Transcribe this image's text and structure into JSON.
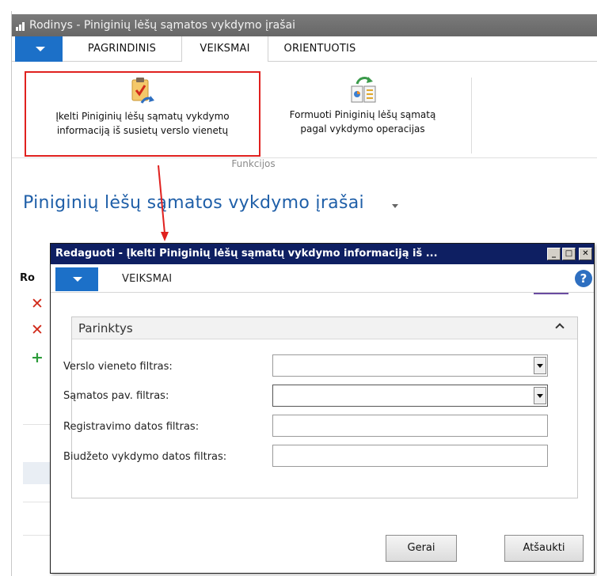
{
  "window": {
    "title": "Rodinys - Piniginių lėšų sąmatos vykdymo įrašai"
  },
  "ribbon": {
    "tabs": [
      "PAGRINDINIS",
      "VEIKSMAI",
      "ORIENTUOTIS"
    ],
    "active_tab": "VEIKSMAI",
    "buttons": [
      {
        "line1": "Įkelti Piniginių lėšų sąmatų vykdymo",
        "line2": "informaciją iš susietų verslo vienetų",
        "highlighted": true
      },
      {
        "line1": "Formuoti Piniginių lėšų sąmatą",
        "line2": "pagal vykdymo operacijas",
        "highlighted": false
      }
    ],
    "group_label": "Funkcijos"
  },
  "page": {
    "title": "Piniginių lėšų sąmatos vykdymo įrašai",
    "column_header": "Ro"
  },
  "dialog": {
    "title": "Redaguoti - Įkelti Piniginių lėšų sąmatų vykdymo informaciją iš ...",
    "menu_tab": "VEIKSMAI",
    "help_icon": "?",
    "section_title": "Parinktys",
    "fields": [
      {
        "label": "Verslo vieneto filtras:",
        "value": "",
        "type": "dropdown"
      },
      {
        "label": "Sąmatos pav. filtras:",
        "value": "",
        "type": "dropdown"
      },
      {
        "label": "Registravimo datos filtras:",
        "value": "",
        "type": "text"
      },
      {
        "label": "Biudžeto vykdymo datos filtras:",
        "value": "",
        "type": "text"
      }
    ],
    "buttons": {
      "ok": "Gerai",
      "cancel": "Atšaukti"
    }
  },
  "colors": {
    "title_bar": "#6e6e6e",
    "ribbon_accent": "#1c70c8",
    "dialog_title_bar": "#0e1f62",
    "highlight_border": "#e0211f",
    "page_title": "#1f5fa8",
    "delete_icon": "#d12a1a",
    "add_icon": "#2c9c3a"
  }
}
